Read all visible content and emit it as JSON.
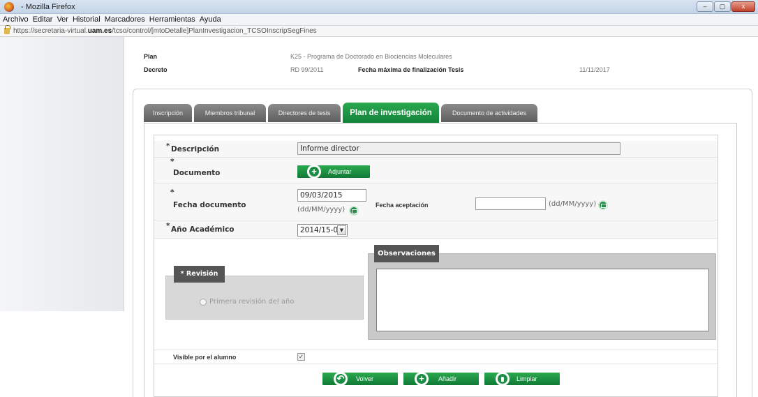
{
  "window": {
    "title": "- Mozilla Firefox",
    "controls": [
      "–",
      "▢",
      "x"
    ]
  },
  "menu": [
    "Archivo",
    "Editar",
    "Ver",
    "Historial",
    "Marcadores",
    "Herramientas",
    "Ayuda"
  ],
  "url": {
    "prefix": "https://secretaria-virtual.",
    "domain": "uam.es",
    "path": "/tcso/control/[mtoDetalle]PlanInvestigacion_TCSOInscripSegFines"
  },
  "header": {
    "plan_label": "Plan",
    "plan_value": "K25 - Programa de Doctorado en Biociencias Moleculares",
    "decreto_label": "Decreto",
    "decreto_value": "RD 99/2011",
    "fecha_max_label": "Fecha máxima de finalización Tesis",
    "fecha_max_value": "11/11/2017"
  },
  "tabs": [
    {
      "label": "Inscripción",
      "active": false
    },
    {
      "label": "Miembros tribunal",
      "active": false
    },
    {
      "label": "Directores de tesis",
      "active": false
    },
    {
      "label": "Plan de investigación",
      "active": true
    },
    {
      "label": "Documento de actividades",
      "active": false
    }
  ],
  "form": {
    "required_mark": "*",
    "descripcion_label": "Descripción",
    "descripcion_value": "Informe director",
    "documento_label": "Documento",
    "adjuntar_label": "Adjuntar",
    "fecha_documento_label": "Fecha documento",
    "fecha_documento_value": "09/03/2015",
    "date_hint": "(dd/MM/yyyy)",
    "fecha_aceptacion_label": "Fecha aceptación",
    "fecha_aceptacion_value": "",
    "anio_label": "Año Académico",
    "anio_value": "2014/15-0",
    "revision_label": "* Revisión",
    "revision_option": "Primera revisión del año",
    "observaciones_label": "Observaciones",
    "visible_label": "Visible por el alumno",
    "visible_checked": true
  },
  "actions": {
    "volver": "Volver",
    "anadir": "Añadir",
    "limpiar": "Limpiar"
  },
  "colors": {
    "accent_green": "#1a8e45",
    "tab_gray": "#6b6b6b"
  }
}
